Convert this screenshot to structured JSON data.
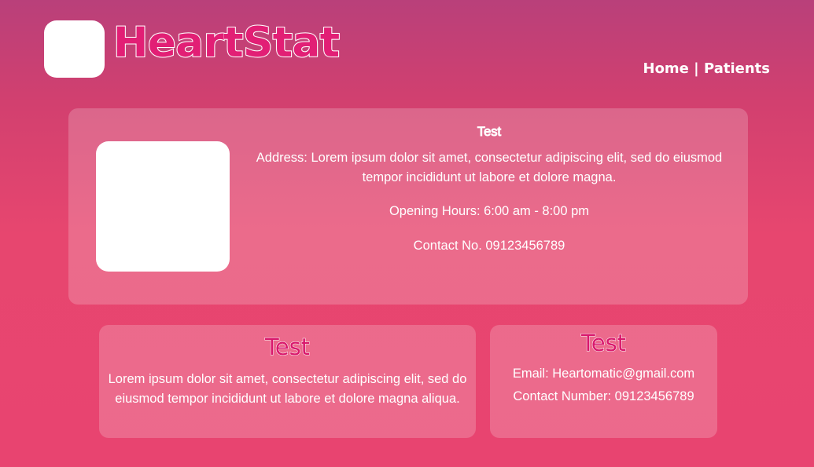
{
  "header": {
    "brand": "HeartStat",
    "nav": {
      "home_label": "Home",
      "separator": " | ",
      "patients_label": "Patients"
    }
  },
  "main_card": {
    "title": "Test",
    "address": "Address: Lorem ipsum dolor sit amet, consectetur adipiscing elit, sed do eiusmod tempor incididunt ut labore et dolore magna.",
    "opening_hours": "Opening Hours: 6:00 am - 8:00 pm",
    "contact": "Contact No. 09123456789"
  },
  "about_card": {
    "title": "Test",
    "body": "Lorem ipsum dolor sit amet, consectetur adipiscing elit, sed do eiusmod tempor incididunt ut labore et dolore magna aliqua."
  },
  "contact_card": {
    "title": "Test",
    "email": "Email: Heartomatic@gmail.com",
    "phone": "Contact Number: 09123456789"
  },
  "colors": {
    "brand_pink": "#e21f75",
    "title_pink": "#d9186c",
    "background_top": "#b9407a",
    "background_bottom": "#e84470"
  }
}
